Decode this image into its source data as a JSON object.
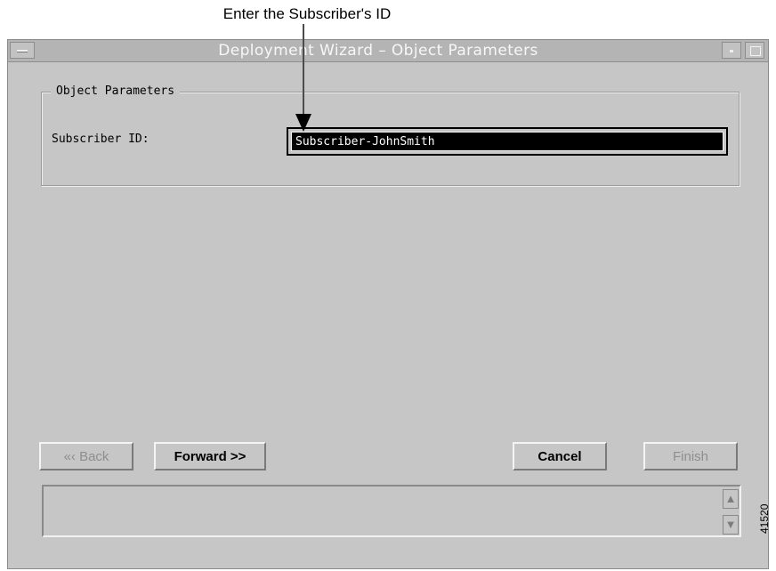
{
  "callout": {
    "text": "Enter the Subscriber's ID"
  },
  "window": {
    "title": "Deployment Wizard – Object Parameters",
    "icons": {
      "menu": "window-menu-icon",
      "minimize": "minimize-icon",
      "maximize": "maximize-icon"
    }
  },
  "object_parameters": {
    "group_label": "Object Parameters",
    "subscriber_id_label": "Subscriber ID:",
    "subscriber_id_value": "Subscriber-JohnSmith"
  },
  "buttons": {
    "back": "«‹ Back",
    "forward": "Forward >>",
    "cancel": "Cancel",
    "finish": "Finish"
  },
  "status": {
    "scroll_up_icon": "▲",
    "scroll_down_icon": "▼"
  },
  "figure_id": "41520",
  "colors": {
    "window_bg": "#c6c6c6",
    "titlebar_bg": "#b4b4b4",
    "input_bg": "#000000",
    "input_text": "#ffffff"
  }
}
